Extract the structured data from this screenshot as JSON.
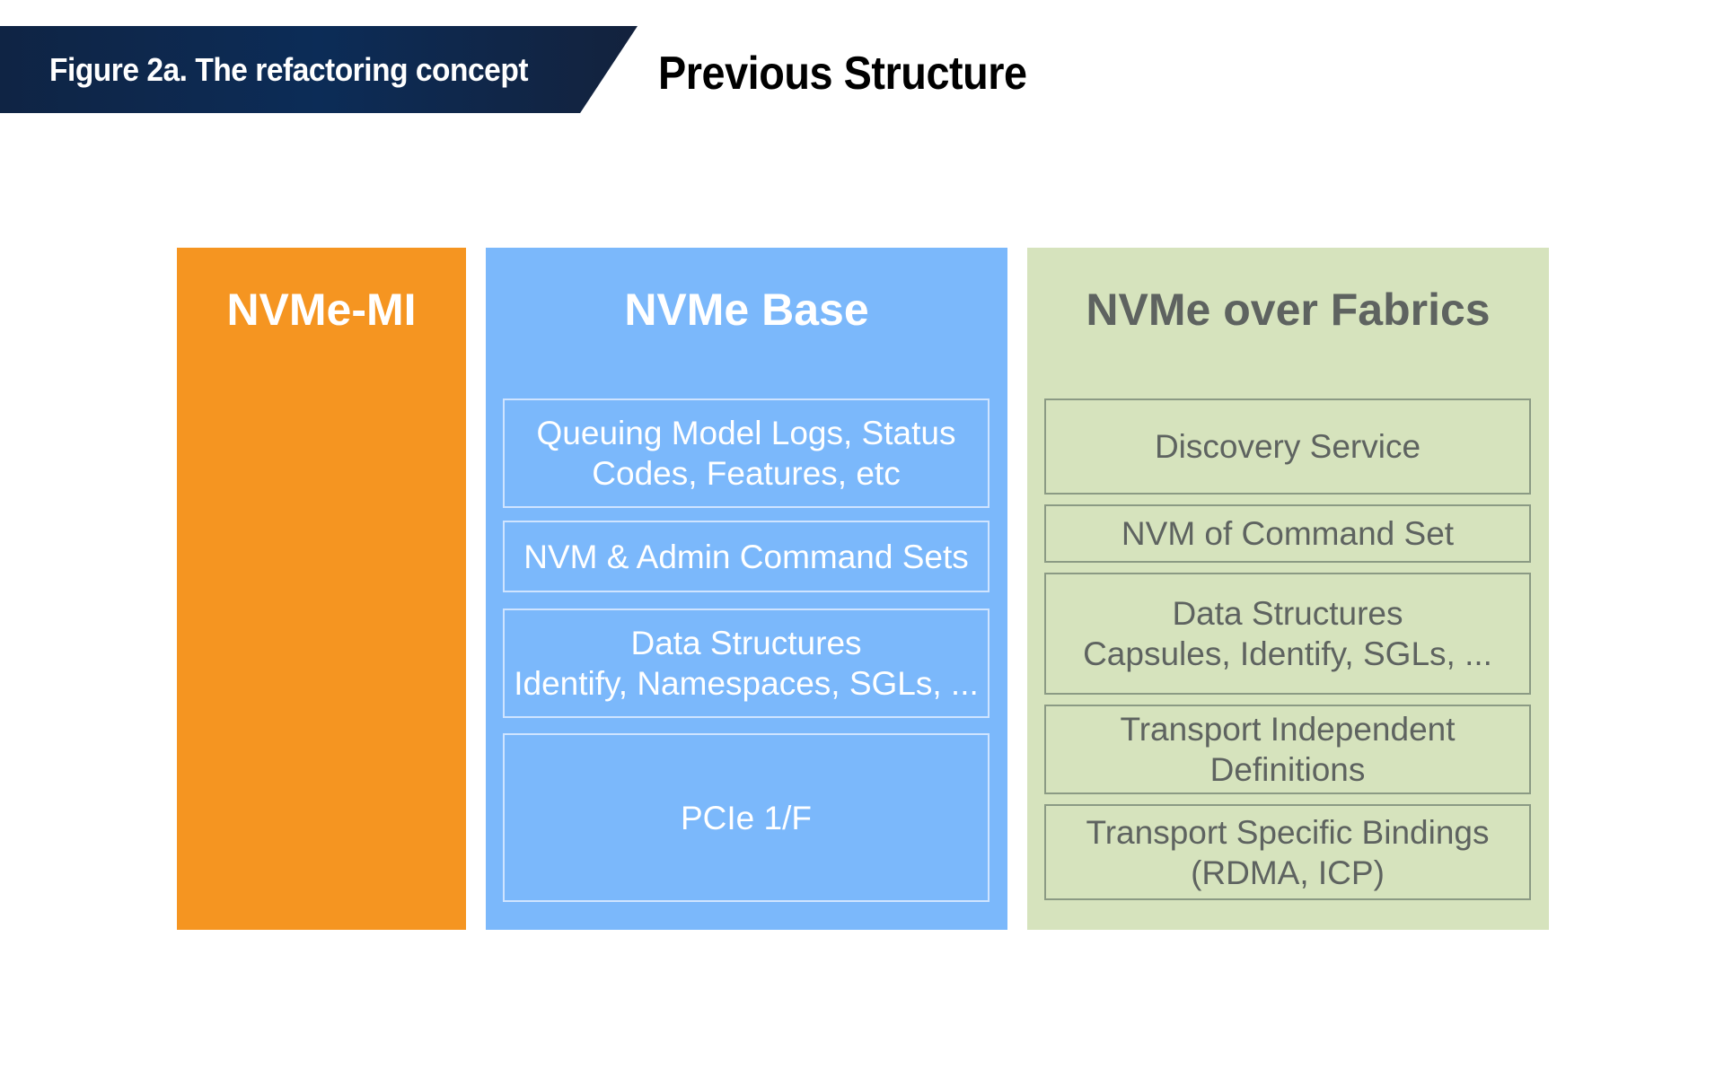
{
  "banner": {
    "label": "Figure 2a. The refactoring concept"
  },
  "title": "Previous Structure",
  "colors": {
    "banner_bg": "#0c2c57",
    "mi": "#f59521",
    "base": "#7bb8fb",
    "fabrics": "#d6e3bd",
    "fabrics_text": "#5e6360"
  },
  "columns": {
    "mi": {
      "title": "NVMe-MI",
      "boxes": []
    },
    "base": {
      "title": "NVMe Base",
      "boxes": [
        "Queuing Model Logs, Status\nCodes, Features, etc",
        "NVM & Admin Command Sets",
        "Data Structures\nIdentify, Namespaces, SGLs, ...",
        "PCIe 1/F"
      ]
    },
    "fabrics": {
      "title": "NVMe over Fabrics",
      "boxes": [
        "Discovery Service",
        "NVM of Command Set",
        "Data Structures\nCapsules, Identify, SGLs, ...",
        "Transport Independent\nDefinitions",
        "Transport Specific Bindings\n(RDMA, ICP)"
      ]
    }
  }
}
